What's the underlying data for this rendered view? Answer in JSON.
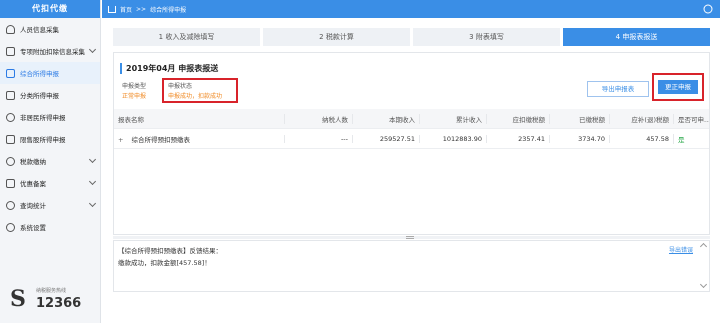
{
  "sidebar": {
    "title": "代扣代缴",
    "items": [
      {
        "label": "人员信息采集",
        "icon": "person-icon",
        "active": false
      },
      {
        "label": "专项附加扣除信息采集",
        "icon": "document-icon",
        "active": false,
        "chevron": true
      },
      {
        "label": "综合所得申报",
        "icon": "chart-icon",
        "active": true
      },
      {
        "label": "分类所得申报",
        "icon": "classify-icon",
        "active": false
      },
      {
        "label": "非居民所得申报",
        "icon": "globe-icon",
        "active": false
      },
      {
        "label": "限售股所得申报",
        "icon": "stock-icon",
        "active": false
      },
      {
        "label": "税款缴纳",
        "icon": "payment-icon",
        "active": false,
        "chevron": true
      },
      {
        "label": "优惠备案",
        "icon": "gift-icon",
        "active": false,
        "chevron": true
      },
      {
        "label": "查询统计",
        "icon": "search-icon",
        "active": false,
        "chevron": true
      },
      {
        "label": "系统设置",
        "icon": "gear-icon",
        "active": false
      }
    ],
    "hotline_caption": "纳税服务热线",
    "hotline_number": "12366"
  },
  "breadcrumb": {
    "home": "首页",
    "separator": ">>",
    "current": "综合所得申报"
  },
  "steps": [
    "1 收入及减除填写",
    "2 税款计算",
    "3 附表填写",
    "4 申报表报送"
  ],
  "panel": {
    "period": "2019年04月",
    "title": "申报表报送",
    "type_label": "申报类型",
    "type_value": "正常申报",
    "status_label": "申报状态",
    "status_value": "申报成功，扣款成功",
    "export_button": "导出申报表",
    "correct_button": "更正申报"
  },
  "table": {
    "headers": [
      "报表名称",
      "纳税人数",
      "本期收入",
      "累计收入",
      "应扣缴税额",
      "已缴税额",
      "应补(退)税额",
      "是否可申..."
    ],
    "rows": [
      {
        "expand": "+",
        "name": "综合所得预扣预缴表",
        "count": "---",
        "income": "259527.51",
        "total_income": "1012883.90",
        "tax_due": "2357.41",
        "tax_paid": "3734.70",
        "tax_diff": "457.58",
        "can_declare": "是"
      }
    ]
  },
  "feedback": {
    "title": "【综合所得预扣预缴表】反馈结果：",
    "message": "缴款成功，扣款金额[457.58]！",
    "export_link": "导出错误"
  },
  "colors": {
    "accent": "#3a8ee6",
    "highlight_box": "#d8232a",
    "status_orange": "#f08a24"
  }
}
